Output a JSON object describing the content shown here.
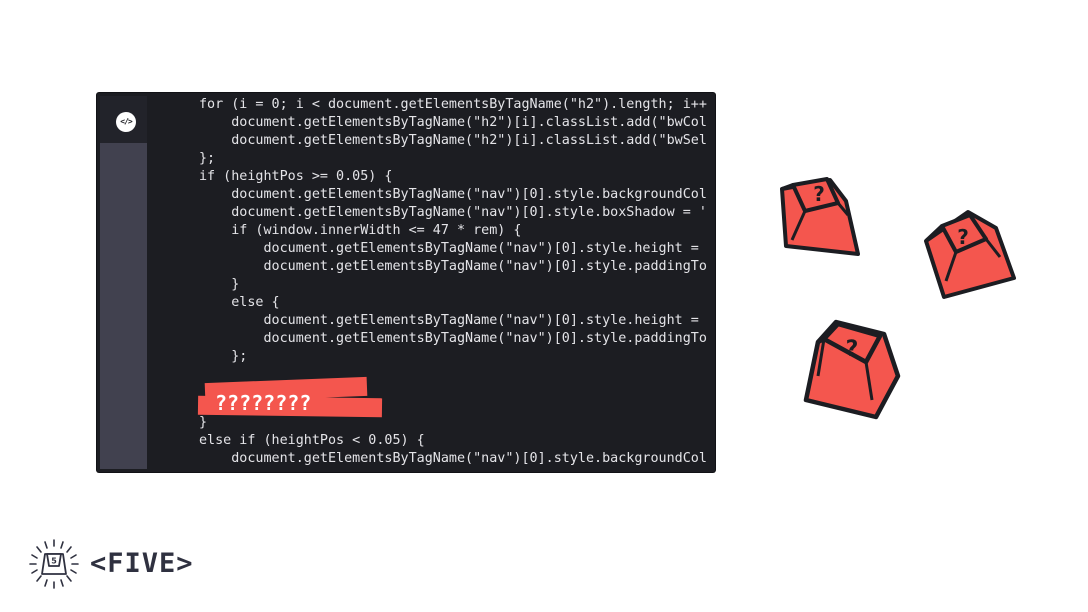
{
  "editor": {
    "code_button_label": "</>",
    "lines": [
      "for (i = 0; i < document.getElementsByTagName(\"h2\").length; i++",
      "    document.getElementsByTagName(\"h2\")[i].classList.add(\"bwCol",
      "    document.getElementsByTagName(\"h2\")[i].classList.add(\"bwSel",
      "};",
      "if (heightPos >= 0.05) {",
      "    document.getElementsByTagName(\"nav\")[0].style.backgroundCol",
      "    document.getElementsByTagName(\"nav\")[0].style.boxShadow = '",
      "    if (window.innerWidth <= 47 * rem) {",
      "        document.getElementsByTagName(\"nav\")[0].style.height =",
      "        document.getElementsByTagName(\"nav\")[0].style.paddingTo",
      "    }",
      "    else {",
      "        document.getElementsByTagName(\"nav\")[0].style.height =",
      "        document.getElementsByTagName(\"nav\")[0].style.paddingTo",
      "    };",
      "",
      "",
      "}",
      "else if (heightPos < 0.05) {",
      "    document.getElementsByTagName(\"nav\")[0].style.backgroundCol"
    ]
  },
  "highlight": {
    "text": "????????"
  },
  "keycaps": {
    "glyph": "?",
    "icon": "keycap-question-icon",
    "count": 3
  },
  "logo": {
    "text": "<FIVE>",
    "key_glyph": "5",
    "icon": "keycap-sunburst-icon"
  },
  "colors": {
    "editor_bg": "#1c1d22",
    "rail": "#41414f",
    "accent_red": "#f4564e",
    "logo_text": "#2f3140"
  }
}
